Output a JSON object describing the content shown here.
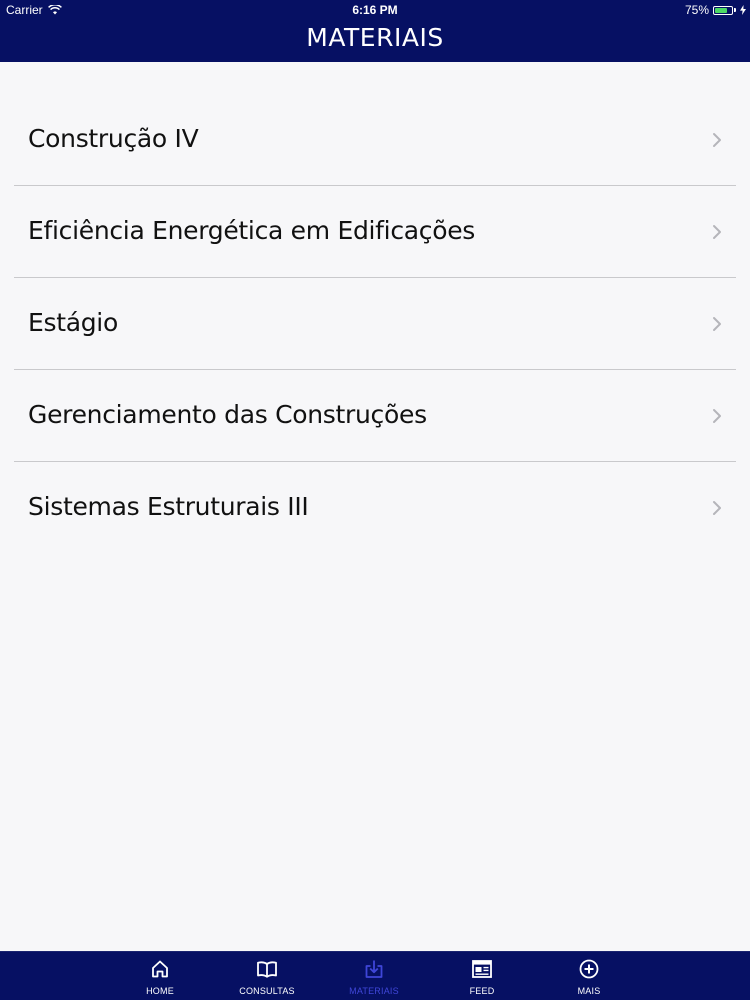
{
  "status_bar": {
    "carrier": "Carrier",
    "time": "6:16 PM",
    "battery": "75%",
    "battery_level": 0.75,
    "battery_color": "#4cd964"
  },
  "header": {
    "title": "MATERIAIS",
    "background": "#061063"
  },
  "list": {
    "items": [
      {
        "label": "Construção IV",
        "icon": "chevron-right-icon"
      },
      {
        "label": "Eficiência Energética em Edificações",
        "icon": "chevron-right-icon"
      },
      {
        "label": "Estágio",
        "icon": "chevron-right-icon"
      },
      {
        "label": "Gerenciamento das Construções",
        "icon": "chevron-right-icon"
      },
      {
        "label": "Sistemas Estruturais III",
        "icon": "chevron-right-icon"
      }
    ]
  },
  "tab_bar": {
    "active_color": "#3f46d8",
    "tabs": [
      {
        "label": "HOME",
        "icon": "home-icon",
        "active": false
      },
      {
        "label": "CONSULTAS",
        "icon": "book-icon",
        "active": false
      },
      {
        "label": "MATERIAIS",
        "icon": "download-icon",
        "active": true
      },
      {
        "label": "FEED",
        "icon": "newspaper-icon",
        "active": false
      },
      {
        "label": "MAIS",
        "icon": "plus-circle-icon",
        "active": false
      }
    ]
  }
}
